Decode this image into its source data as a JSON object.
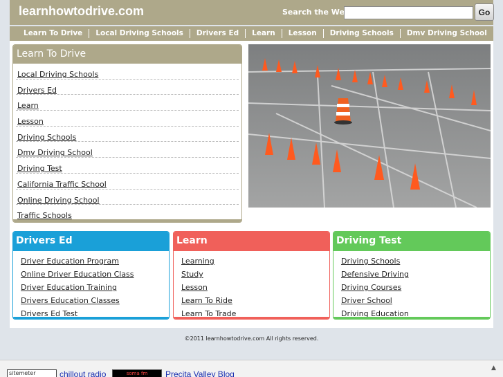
{
  "header": {
    "logo": "learnhowtodrive.com",
    "search_label": "Search the Web:",
    "search_value": "",
    "go_label": "Go"
  },
  "nav": [
    "Learn To Drive",
    "Local Driving Schools",
    "Drivers Ed",
    "Learn",
    "Lesson",
    "Driving Schools",
    "Dmv Driving School"
  ],
  "left_box": {
    "title": "Learn To Drive",
    "links": [
      "Local Driving Schools",
      "Drivers Ed",
      "Learn",
      "Lesson",
      "Driving Schools",
      "Dmv Driving School",
      "Driving Test",
      "California Traffic School",
      "Online Driving School",
      "Traffic Schools"
    ]
  },
  "columns": [
    {
      "title": "Drivers Ed",
      "color": "#1aa0d8",
      "links": [
        "Driver Education Program",
        "Online Driver Education Class",
        "Driver Education Training",
        "Drivers Education Classes",
        "Drivers Ed Test"
      ]
    },
    {
      "title": "Learn",
      "color": "#f0605a",
      "links": [
        "Learning",
        "Study",
        "Lesson",
        "Learn To Ride",
        "Learn To Trade"
      ]
    },
    {
      "title": "Driving Test",
      "color": "#63c95a",
      "links": [
        "Driving Schools",
        "Defensive Driving",
        "Driving Courses",
        "Driver School",
        "Driving Education"
      ]
    }
  ],
  "footer": "©2011 learnhowtodrive.com All rights reserved.",
  "bottom_strip": {
    "sitemeter": "sitemeter",
    "chillout": "chillout radio",
    "somafm": "soma fm",
    "precita": "Precita Valley Blog"
  },
  "colors": {
    "header_bg": "#aea88a",
    "page_bg": "#dfe4ea"
  }
}
